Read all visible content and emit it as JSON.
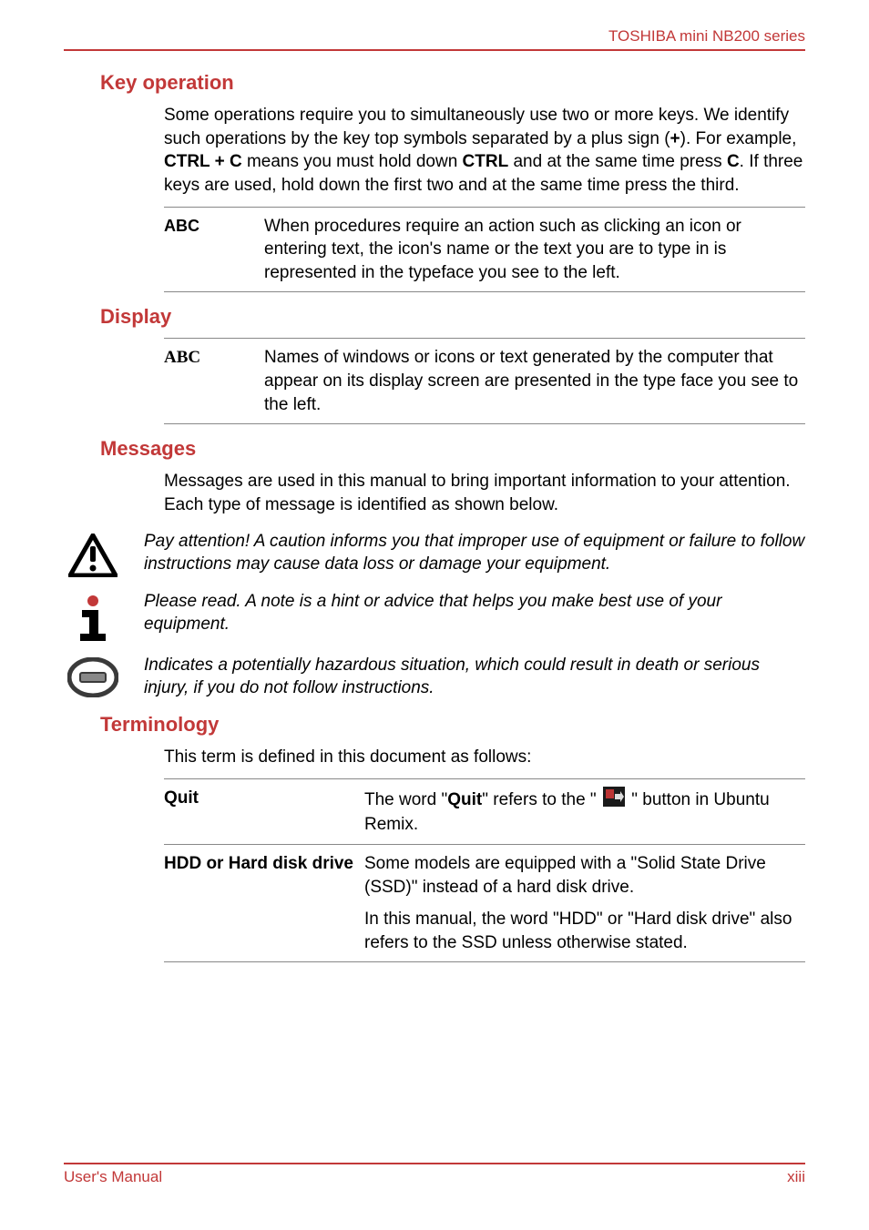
{
  "header": {
    "series": "TOSHIBA mini NB200 series"
  },
  "sections": {
    "key_operation": {
      "title": "Key operation",
      "intro_parts": [
        "Some operations require you to simultaneously use two or more keys. We identify such operations by the key top symbols separated by a plus sign (",
        "+",
        "). For example, ",
        "CTRL + C",
        " means you must hold down ",
        "CTRL",
        " and at the same time press ",
        "C",
        ". If three keys are used, hold down the first two and at the same time press the third."
      ],
      "table": {
        "key": "ABC",
        "val": "When procedures require an action such as clicking an icon or entering text, the icon's name or the text you are to type in is represented in the typeface you see to the left."
      }
    },
    "display": {
      "title": "Display",
      "table": {
        "key": "ABC",
        "val": "Names of windows or icons or text generated by the computer that appear on its display screen are presented in the type face you see to the left."
      }
    },
    "messages": {
      "title": "Messages",
      "intro": "Messages are used in this manual to bring important information to your attention. Each type of message is identified as shown below.",
      "caution": "Pay attention! A caution informs you that improper use of equipment or failure to follow instructions may cause data loss or damage your equipment.",
      "note": "Please read. A note is a hint or advice that helps you make best use of your equipment.",
      "warning": "Indicates a potentially hazardous situation, which could result in death or serious injury, if you do not follow instructions."
    },
    "terminology": {
      "title": "Terminology",
      "intro": "This term is defined in this document as follows:",
      "rows": {
        "quit": {
          "key": "Quit",
          "val_pre": "The word \"",
          "val_bold": "Quit",
          "val_mid": "\" refers to the \" ",
          "val_post": " \" button in Ubuntu Remix."
        },
        "hdd": {
          "key": "HDD or Hard disk drive",
          "val1": "Some models are equipped with a \"Solid State Drive (SSD)\" instead of a hard disk drive.",
          "val2": "In this manual, the word \"HDD\" or \"Hard disk drive\" also refers to the SSD unless otherwise stated."
        }
      }
    }
  },
  "footer": {
    "left": "User's Manual",
    "right": "xiii"
  }
}
